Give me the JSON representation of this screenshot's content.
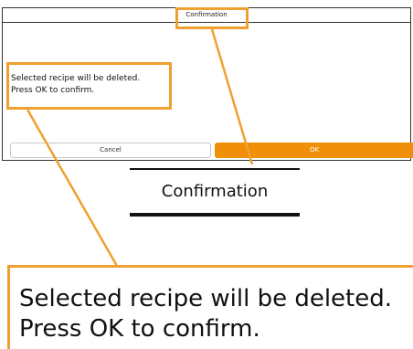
{
  "dialog": {
    "title": "Confirmation",
    "message_line1": "Selected recipe will be deleted.",
    "message_line2": "Press OK to confirm.",
    "cancel_label": "Cancel",
    "ok_label": "OK"
  },
  "zoom": {
    "title": "Confirmation",
    "message_line1": "Selected recipe will be deleted.",
    "message_line2": "Press OK to confirm."
  },
  "colors": {
    "accent": "#f0900a",
    "callout": "#f0a030",
    "border": "#333333"
  }
}
